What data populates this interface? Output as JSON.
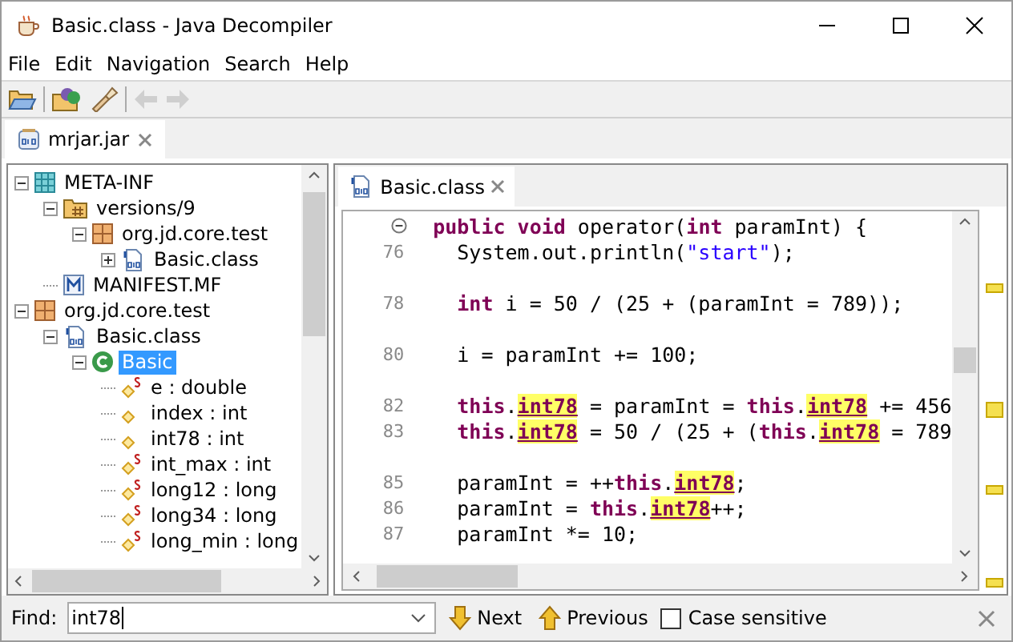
{
  "window": {
    "title": "Basic.class - Java Decompiler"
  },
  "menu": [
    "File",
    "Edit",
    "Navigation",
    "Search",
    "Help"
  ],
  "toolbar": [
    {
      "kind": "open",
      "disabled": false
    },
    {
      "kind": "types",
      "disabled": false
    },
    {
      "kind": "search",
      "disabled": false
    },
    {
      "kind": "back",
      "disabled": true
    },
    {
      "kind": "forward",
      "disabled": true
    }
  ],
  "file_tabs": [
    {
      "label": "mrjar.jar",
      "selected": true
    }
  ],
  "tree": [
    {
      "label": "META-INF",
      "kind": "meta",
      "expanded": true,
      "selected": false,
      "children": [
        {
          "label": "versions/9",
          "kind": "folder",
          "expanded": true,
          "selected": false,
          "children": [
            {
              "label": "org.jd.core.test",
              "kind": "package",
              "expanded": true,
              "selected": false,
              "children": [
                {
                  "label": "Basic.class",
                  "kind": "classfile",
                  "expanded": false,
                  "selected": false
                }
              ]
            }
          ]
        },
        {
          "label": "MANIFEST.MF",
          "kind": "manifest",
          "selected": false
        }
      ]
    },
    {
      "label": "org.jd.core.test",
      "kind": "package",
      "expanded": true,
      "selected": false,
      "children": [
        {
          "label": "Basic.class",
          "kind": "classfile",
          "expanded": true,
          "selected": false,
          "children": [
            {
              "label": "Basic",
              "kind": "class",
              "expanded": true,
              "selected": true,
              "children": [
                {
                  "label": "e : double",
                  "kind": "field",
                  "static": true,
                  "selected": false
                },
                {
                  "label": "index : int",
                  "kind": "field",
                  "static": false,
                  "selected": false
                },
                {
                  "label": "int78 : int",
                  "kind": "field",
                  "static": false,
                  "selected": false
                },
                {
                  "label": "int_max : int",
                  "kind": "field",
                  "static": true,
                  "selected": false
                },
                {
                  "label": "long12 : long",
                  "kind": "field",
                  "static": true,
                  "selected": false
                },
                {
                  "label": "long34 : long",
                  "kind": "field",
                  "static": true,
                  "selected": false
                },
                {
                  "label": "long_min : long",
                  "kind": "field",
                  "static": true,
                  "selected": false
                }
              ]
            }
          ]
        }
      ]
    }
  ],
  "editor_tabs": [
    {
      "label": "Basic.class",
      "selected": true
    }
  ],
  "code": [
    {
      "fold": true,
      "gap_before": false,
      "tokens": [
        {
          "kind": "keyword",
          "text": "public void"
        },
        {
          "kind": "plain",
          "text": " operator("
        },
        {
          "kind": "keyword",
          "text": "int"
        },
        {
          "kind": "plain",
          "text": " paramInt) {"
        }
      ]
    },
    {
      "number": "76",
      "gap_before": false,
      "tokens": [
        {
          "kind": "plain",
          "text": "  System.out.println("
        },
        {
          "kind": "string",
          "text": "\"start\""
        },
        {
          "kind": "plain",
          "text": ");"
        }
      ]
    },
    {
      "number": "78",
      "gap_before": true,
      "tokens": [
        {
          "kind": "keyword",
          "text": "  int"
        },
        {
          "kind": "plain",
          "text": " i = 50 / (25 + (paramInt = 789));"
        }
      ]
    },
    {
      "number": "80",
      "gap_before": true,
      "tokens": [
        {
          "kind": "plain",
          "text": "  i = paramInt += 100;"
        }
      ]
    },
    {
      "number": "82",
      "gap_before": true,
      "tokens": [
        {
          "kind": "keyword",
          "text": "  this"
        },
        {
          "kind": "plain",
          "text": "."
        },
        {
          "kind": "match",
          "text": "int78"
        },
        {
          "kind": "plain",
          "text": " = paramInt = "
        },
        {
          "kind": "keyword",
          "text": "this"
        },
        {
          "kind": "plain",
          "text": "."
        },
        {
          "kind": "match",
          "text": "int78"
        },
        {
          "kind": "plain",
          "text": " += 456"
        }
      ]
    },
    {
      "number": "83",
      "gap_before": false,
      "tokens": [
        {
          "kind": "keyword",
          "text": "  this"
        },
        {
          "kind": "plain",
          "text": "."
        },
        {
          "kind": "match",
          "text": "int78"
        },
        {
          "kind": "plain",
          "text": " = 50 / (25 + ("
        },
        {
          "kind": "keyword",
          "text": "this"
        },
        {
          "kind": "plain",
          "text": "."
        },
        {
          "kind": "match",
          "text": "int78"
        },
        {
          "kind": "plain",
          "text": " = 789"
        }
      ]
    },
    {
      "number": "85",
      "gap_before": true,
      "tokens": [
        {
          "kind": "plain",
          "text": "  paramInt = ++"
        },
        {
          "kind": "keyword",
          "text": "this"
        },
        {
          "kind": "plain",
          "text": "."
        },
        {
          "kind": "match",
          "text": "int78"
        },
        {
          "kind": "plain",
          "text": ";"
        }
      ]
    },
    {
      "number": "86",
      "gap_before": false,
      "tokens": [
        {
          "kind": "plain",
          "text": "  paramInt = "
        },
        {
          "kind": "keyword",
          "text": "this"
        },
        {
          "kind": "plain",
          "text": "."
        },
        {
          "kind": "match",
          "text": "int78"
        },
        {
          "kind": "plain",
          "text": "++;"
        }
      ]
    },
    {
      "number": "87",
      "gap_before": false,
      "tokens": [
        {
          "kind": "plain",
          "text": "  paramInt *= 10;"
        }
      ]
    }
  ],
  "find_bar": {
    "label": "Find:",
    "value": "int78",
    "next": "Next",
    "previous": "Previous",
    "case_sensitive": {
      "label": "Case sensitive",
      "checked": false
    }
  }
}
